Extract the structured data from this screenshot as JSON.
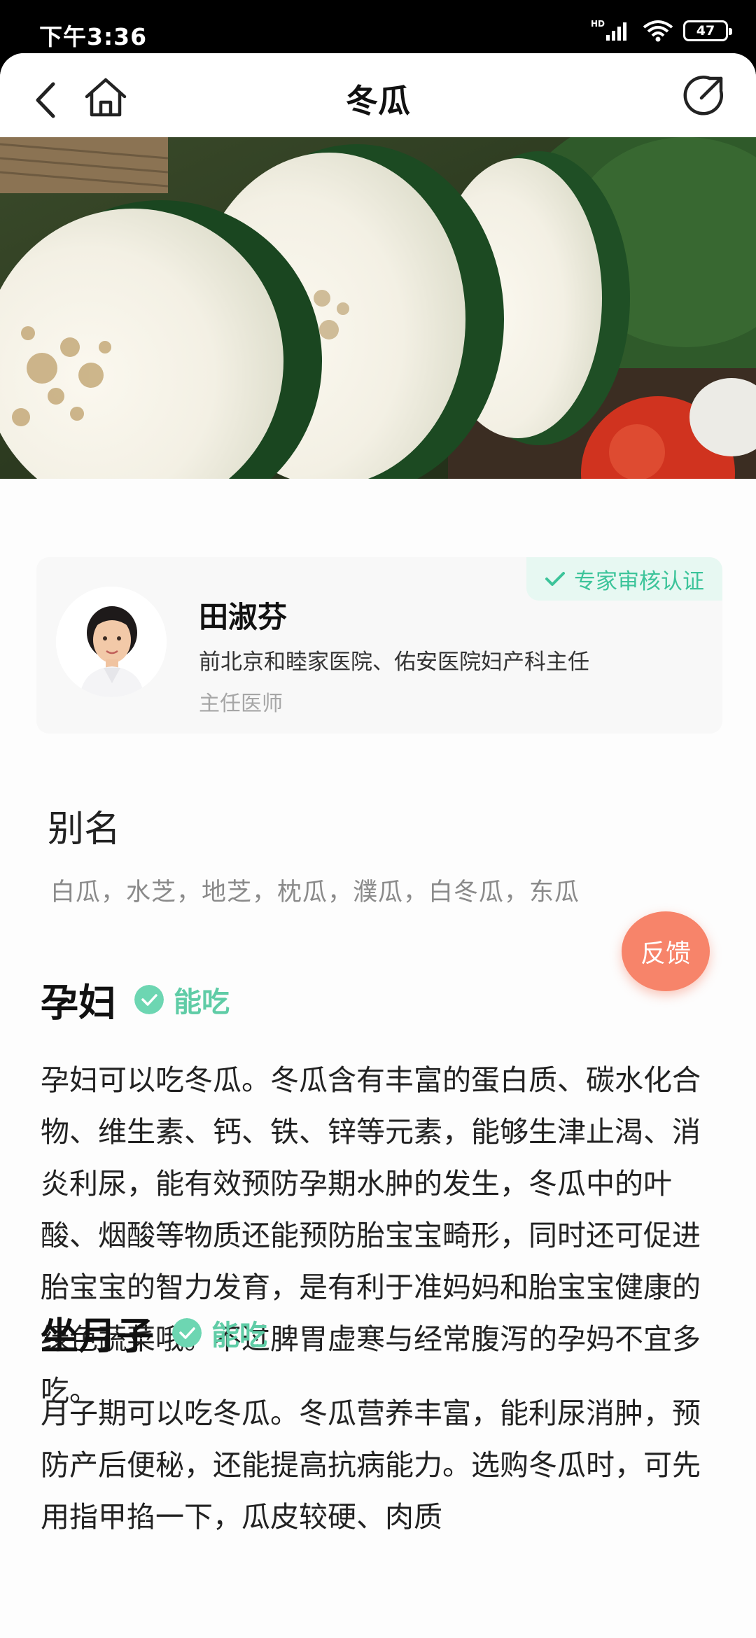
{
  "status_bar": {
    "time": "下午3:36",
    "network_label": "HD",
    "battery": "47",
    "icons": [
      "signal-icon",
      "wifi-icon",
      "battery-icon"
    ]
  },
  "nav": {
    "title": "冬瓜",
    "icons": [
      "back-icon",
      "home-icon",
      "share-icon"
    ]
  },
  "hero": {
    "image": "winter-melon-photo"
  },
  "expert": {
    "badge": "专家审核认证",
    "name": "田淑芬",
    "organization": "前北京和睦家医院、佑安医院妇产科主任",
    "title": "主任医师"
  },
  "alias": {
    "heading": "别名",
    "names": "白瓜，水芝，地芝，枕瓜，濮瓜，白冬瓜，东瓜"
  },
  "sections": [
    {
      "title": "孕妇",
      "verdict": "能吃",
      "text": "孕妇可以吃冬瓜。冬瓜含有丰富的蛋白质、碳水化合物、维生素、钙、铁、锌等元素，能够生津止渴、消炎利尿，能有效预防孕期水肿的发生，冬瓜中的叶酸、烟酸等物质还能预防胎宝宝畸形，同时还可促进胎宝宝的智力发育，是有利于准妈妈和胎宝宝健康的绿色蔬菜哦。不过脾胃虚寒与经常腹泻的孕妈不宜多吃。"
    },
    {
      "title": "坐月子",
      "verdict": "能吃",
      "text": "月子期可以吃冬瓜。冬瓜营养丰富，能利尿消肿，预防产后便秘，还能提高抗病能力。选购冬瓜时，可先用指甲掐一下，瓜皮较硬、肉质"
    }
  ],
  "feedback": {
    "label": "反馈"
  },
  "colors": {
    "accent_green": "#5fcca6",
    "badge_bg": "#e7f8f2",
    "feedback_orange": "#f7846a"
  }
}
